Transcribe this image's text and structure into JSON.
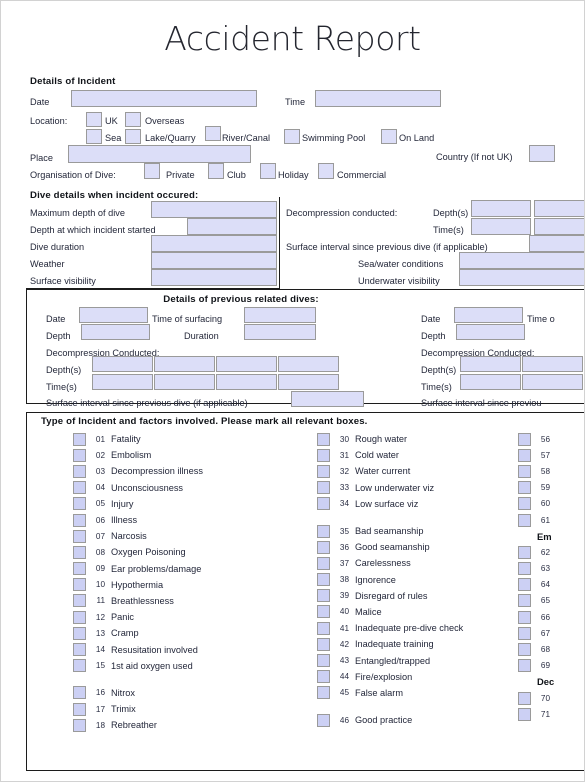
{
  "document": {
    "title": "Accident Report"
  },
  "incident": {
    "heading": "Details of Incident",
    "date_label": "Date",
    "time_label": "Time",
    "location_label": "Location:",
    "location_options_row1": [
      "UK",
      "Overseas"
    ],
    "location_options_row2": [
      "Sea",
      "Lake/Quarry",
      "River/Canal",
      "Swimming Pool",
      "On Land"
    ],
    "place_label": "Place",
    "country_label": "Country (If not UK)",
    "organisation_label": "Organisation of Dive:",
    "organisation_options": [
      "Private",
      "Club",
      "Holiday",
      "Commercial"
    ],
    "date_value": "",
    "time_value": "",
    "place_value": "",
    "country_value": ""
  },
  "dive_details": {
    "heading": "Dive details when incident occured:",
    "left_rows": [
      {
        "label": "Maximum depth of dive",
        "value": ""
      },
      {
        "label": "Depth at which incident started",
        "value": ""
      },
      {
        "label": "Dive duration",
        "value": ""
      },
      {
        "label": "Weather",
        "value": ""
      },
      {
        "label": "Surface visibility",
        "value": ""
      }
    ],
    "right_rows": [
      {
        "label": "Decompression conducted:",
        "sublabel": "Depth(s)",
        "value": ""
      },
      {
        "label": "",
        "sublabel": "Time(s)",
        "value": ""
      },
      {
        "label": "Surface interval since previous dive (if applicable)",
        "sublabel": "",
        "value": ""
      },
      {
        "label": "Sea/water conditions",
        "sublabel": "",
        "value": ""
      },
      {
        "label": "Underwater visibility",
        "sublabel": "",
        "value": ""
      }
    ]
  },
  "previous_dives": {
    "heading": "Details of previous related dives:",
    "left": {
      "date_label": "Date",
      "time_of_surfacing_label": "Time of surfacing",
      "depth_label": "Depth",
      "duration_label": "Duration",
      "decompression_label": "Decompression Conducted:",
      "depths_label": "Depth(s)",
      "times_label": "Time(s)",
      "surface_interval_label": "Surface interval since previous dive (if applicable)",
      "date_value": "",
      "time_of_surfacing_value": "",
      "depth_value": "",
      "duration_value": "",
      "surface_interval_value": ""
    },
    "right": {
      "date_label": "Date",
      "time_of_surfacing_label": "Time o",
      "depth_label": "Depth",
      "decompression_label": "Decompression Conducted:",
      "depths_label": "Depth(s)",
      "times_label": "Time(s)",
      "surface_interval_label": "Surface interval since previou",
      "date_value": "",
      "depth_value": ""
    }
  },
  "incident_types": {
    "heading": "Type of Incident and factors involved. Please mark all relevant boxes.",
    "column1": [
      {
        "num": "01",
        "label": "Fatality",
        "gap": false
      },
      {
        "num": "02",
        "label": "Embolism",
        "gap": false
      },
      {
        "num": "03",
        "label": "Decompression illness",
        "gap": false
      },
      {
        "num": "04",
        "label": "Unconsciousness",
        "gap": false
      },
      {
        "num": "05",
        "label": "Injury",
        "gap": false
      },
      {
        "num": "06",
        "label": "Illness",
        "gap": false
      },
      {
        "num": "07",
        "label": "Narcosis",
        "gap": false
      },
      {
        "num": "08",
        "label": "Oxygen Poisoning",
        "gap": false
      },
      {
        "num": "09",
        "label": "Ear problems/damage",
        "gap": false
      },
      {
        "num": "10",
        "label": "Hypothermia",
        "gap": false
      },
      {
        "num": "11",
        "label": "Breathlessness",
        "gap": false
      },
      {
        "num": "12",
        "label": "Panic",
        "gap": false
      },
      {
        "num": "13",
        "label": "Cramp",
        "gap": false
      },
      {
        "num": "14",
        "label": "Resusitation involved",
        "gap": false
      },
      {
        "num": "15",
        "label": "1st aid oxygen used",
        "gap": false
      },
      {
        "num": "16",
        "label": "Nitrox",
        "gap": true
      },
      {
        "num": "17",
        "label": "Trimix",
        "gap": false
      },
      {
        "num": "18",
        "label": "Rebreather",
        "gap": false
      }
    ],
    "column2": [
      {
        "num": "30",
        "label": "Rough water",
        "gap": false
      },
      {
        "num": "31",
        "label": "Cold water",
        "gap": false
      },
      {
        "num": "32",
        "label": "Water current",
        "gap": false
      },
      {
        "num": "33",
        "label": "Low underwater viz",
        "gap": false
      },
      {
        "num": "34",
        "label": "Low surface viz",
        "gap": false
      },
      {
        "num": "35",
        "label": "Bad seamanship",
        "gap": true
      },
      {
        "num": "36",
        "label": "Good seamanship",
        "gap": false
      },
      {
        "num": "37",
        "label": "Carelessness",
        "gap": false
      },
      {
        "num": "38",
        "label": "Ignorence",
        "gap": false
      },
      {
        "num": "39",
        "label": "Disregard of rules",
        "gap": false
      },
      {
        "num": "40",
        "label": "Malice",
        "gap": false
      },
      {
        "num": "41",
        "label": "Inadequate pre-dive check",
        "gap": false
      },
      {
        "num": "42",
        "label": "Inadequate training",
        "gap": false
      },
      {
        "num": "43",
        "label": "Entangled/trapped",
        "gap": false
      },
      {
        "num": "44",
        "label": "Fire/explosion",
        "gap": false
      },
      {
        "num": "45",
        "label": "False alarm",
        "gap": false
      },
      {
        "num": "46",
        "label": "Good practice",
        "gap": true
      }
    ],
    "column3": [
      {
        "type": "item",
        "num": "56",
        "label": "",
        "gap": false
      },
      {
        "type": "item",
        "num": "57",
        "label": "",
        "gap": false
      },
      {
        "type": "item",
        "num": "58",
        "label": "",
        "gap": false
      },
      {
        "type": "item",
        "num": "59",
        "label": "",
        "gap": false
      },
      {
        "type": "item",
        "num": "60",
        "label": "",
        "gap": false
      },
      {
        "type": "item",
        "num": "61",
        "label": "",
        "gap": false
      },
      {
        "type": "head",
        "num": "",
        "label": "Em",
        "gap": true
      },
      {
        "type": "item",
        "num": "62",
        "label": "",
        "gap": false
      },
      {
        "type": "item",
        "num": "63",
        "label": "",
        "gap": false
      },
      {
        "type": "item",
        "num": "64",
        "label": "",
        "gap": false
      },
      {
        "type": "item",
        "num": "65",
        "label": "",
        "gap": false
      },
      {
        "type": "item",
        "num": "66",
        "label": "",
        "gap": false
      },
      {
        "type": "item",
        "num": "67",
        "label": "",
        "gap": false
      },
      {
        "type": "item",
        "num": "68",
        "label": "",
        "gap": false
      },
      {
        "type": "item",
        "num": "69",
        "label": "",
        "gap": false
      },
      {
        "type": "head",
        "num": "",
        "label": "Dec",
        "gap": true
      },
      {
        "type": "item",
        "num": "70",
        "label": "",
        "gap": false
      },
      {
        "type": "item",
        "num": "71",
        "label": "",
        "gap": false
      }
    ]
  },
  "colors": {
    "field_fill": "#dcdef8",
    "field_border": "#9a9a9a",
    "checkbox_fill": "#ccd0f4",
    "frame_border": "#1c1c1c",
    "text": "#23273a",
    "page_border": "#d2d2d2"
  }
}
